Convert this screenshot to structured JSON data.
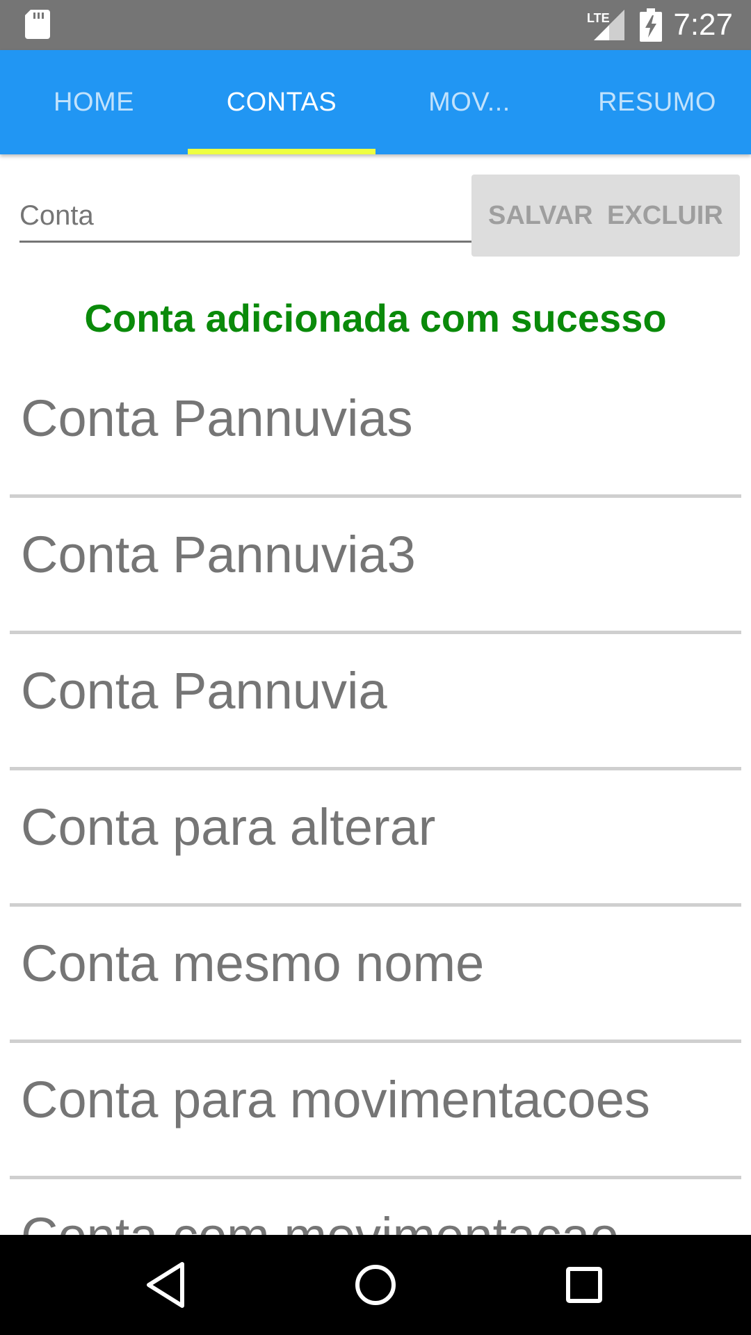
{
  "status_bar": {
    "time": "7:27",
    "network": "LTE",
    "icons": [
      "sd-card-icon",
      "lte-signal-icon",
      "battery-charging-icon"
    ]
  },
  "tabs": [
    {
      "label": "HOME",
      "active": false
    },
    {
      "label": "CONTAS",
      "active": true
    },
    {
      "label": "MOV...",
      "active": false
    },
    {
      "label": "RESUMO",
      "active": false
    }
  ],
  "form": {
    "placeholder": "Conta",
    "value": "",
    "save_label": "SALVAR",
    "delete_label": "EXCLUIR"
  },
  "message": "Conta adicionada com sucesso",
  "accounts": [
    "Conta Pannuvias",
    "Conta Pannuvia3",
    "Conta Pannuvia",
    "Conta para alterar",
    "Conta mesmo nome",
    "Conta para movimentacoes",
    "Conta com movimentacao"
  ],
  "colors": {
    "tab_bar": "#2196F3",
    "tab_indicator": "#EEFF41",
    "message": "#0A8A0A",
    "status_bar": "#757575",
    "button_bg": "#DDDDDD"
  },
  "nav": {
    "icons": [
      "back-icon",
      "home-icon",
      "recents-icon"
    ]
  }
}
